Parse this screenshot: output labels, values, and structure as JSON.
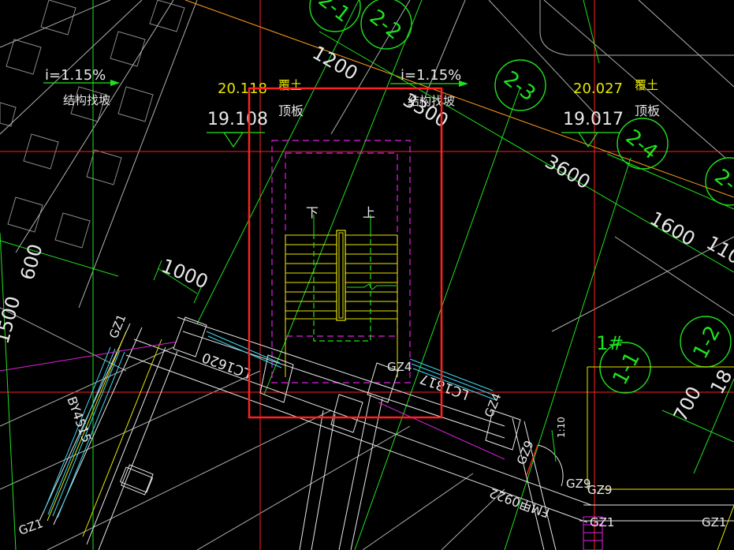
{
  "colors": {
    "background": "#000000",
    "white": "#e8e8e8",
    "green": "#1fe21f",
    "yellow": "#e6e600",
    "red": "#ff2020",
    "magenta": "#e020e0",
    "cyan": "#40d8f0",
    "orange": "#ff9a20",
    "gray": "#9a9a9a"
  },
  "slope_left": {
    "value": "i=1.15%",
    "caption": "结构找坡"
  },
  "slope_right": {
    "value": "i=1.15%",
    "caption": "结构找坡"
  },
  "elev_left": {
    "top": "20.118",
    "bottom": "19.108",
    "label_top": "覆土",
    "label_bottom": "顶板"
  },
  "elev_right": {
    "top": "20.027",
    "bottom": "19.017",
    "label_top": "覆土",
    "label_bottom": "顶板"
  },
  "dims": {
    "d1200": "1200",
    "d3300": "3300",
    "d3600": "3600",
    "d1600": "1600",
    "d1100": "110",
    "d1000": "1000",
    "d600": "600",
    "d1500": "1500",
    "d700": "700",
    "d18": "18"
  },
  "axis_bubbles": {
    "a2_1": "2-1",
    "a2_2": "2-2",
    "a2_3": "2-3",
    "a2_4": "2-4",
    "a2_5": "2-",
    "a1_1": "1-1",
    "a1_2": "1-2"
  },
  "stair": {
    "down": "下",
    "up": "上"
  },
  "tags": {
    "gz_top": "GZ1",
    "gz4_a": "GZ4",
    "gz4_b": "GZ4",
    "gz9_a": "GZ9",
    "gz9_b": "GZ9",
    "gz9_c": "GZ9",
    "gz1_bl": "GZ1",
    "gz1_b2": "GZ1",
    "gz1_br": "GZ1",
    "lc1620": "LC1620",
    "lc1817": "LC1817",
    "by4515": "BY4515",
    "fm0922": "FM甲0922",
    "ratio": "1:10",
    "building": "1#"
  }
}
